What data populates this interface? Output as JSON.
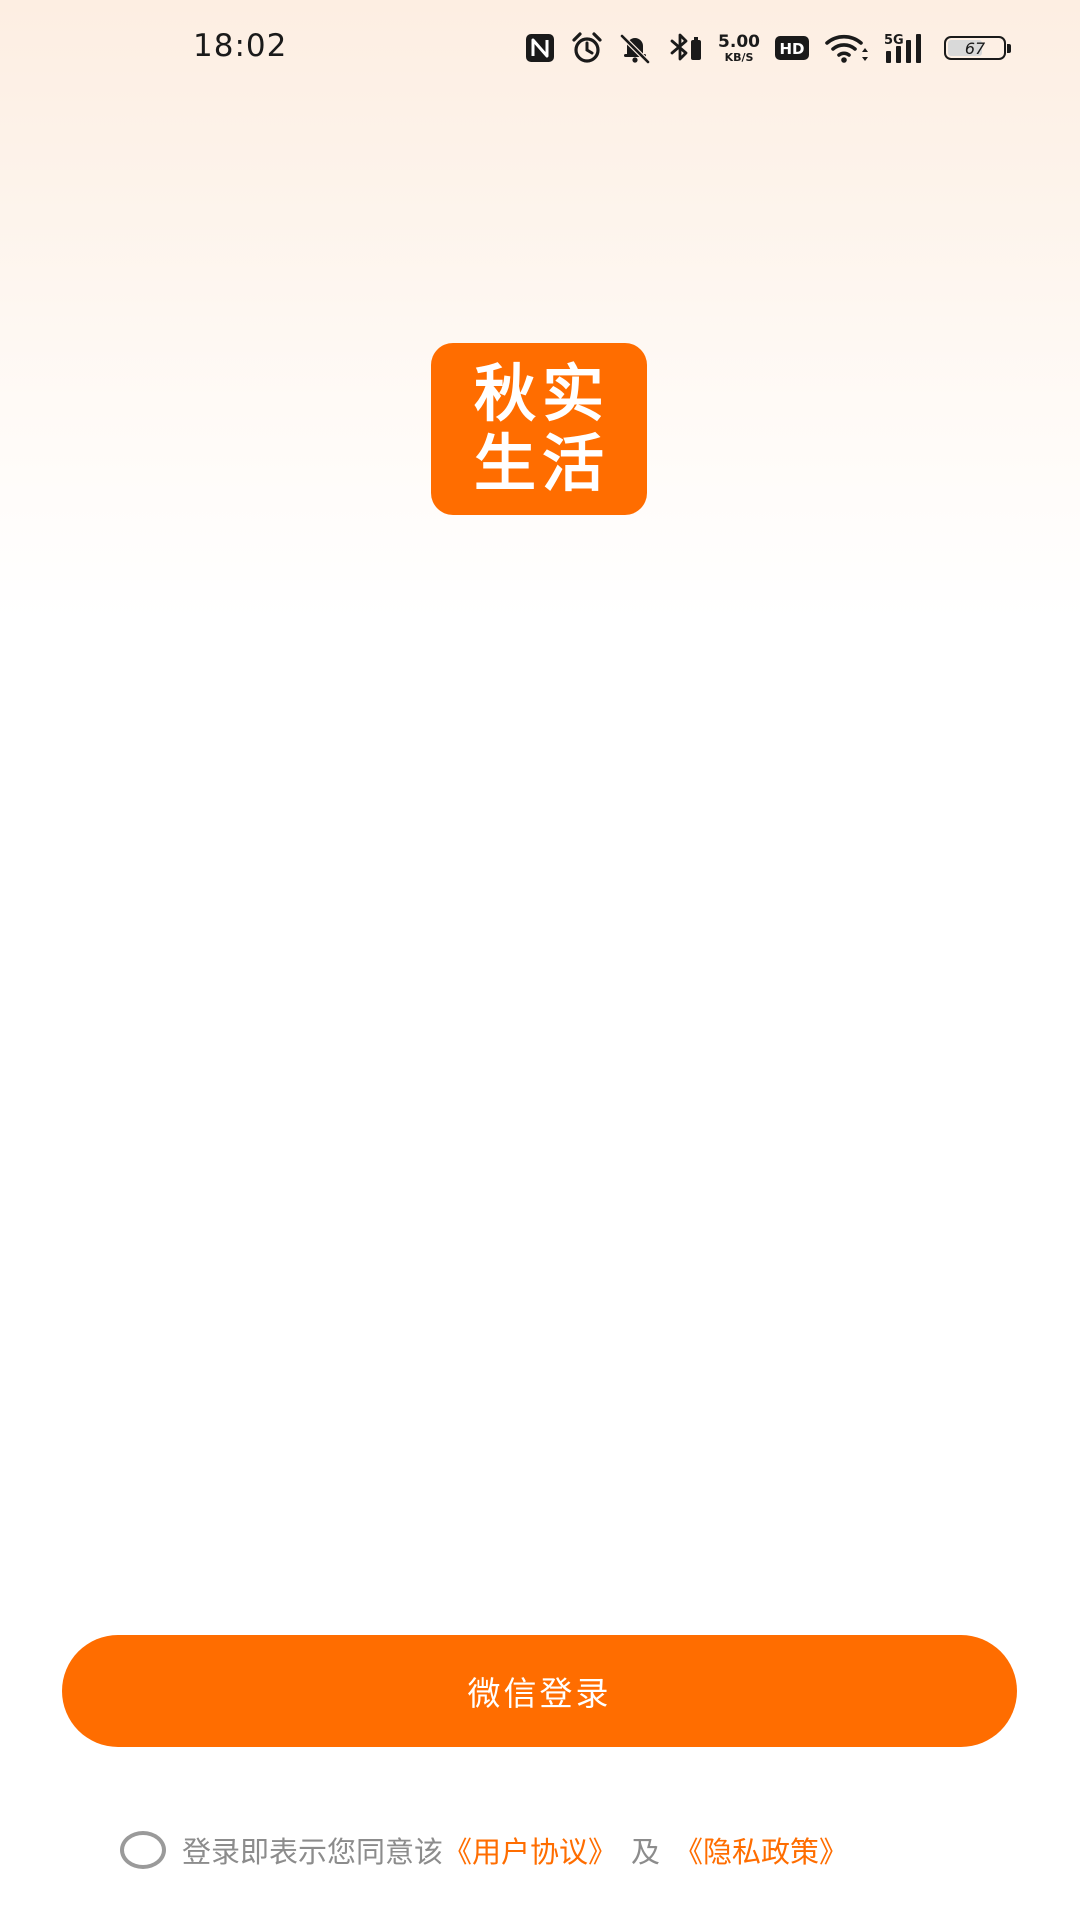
{
  "status_bar": {
    "time": "18:02",
    "net_speed_value": "5.00",
    "net_speed_unit": "KB/S",
    "hd_label": "HD",
    "network_label": "5G",
    "battery_level": "67",
    "icons": [
      "nfc-icon",
      "alarm-icon",
      "mute-icon",
      "bluetooth-icon",
      "hd-icon",
      "wifi-icon",
      "signal-icon",
      "battery-icon"
    ]
  },
  "logo": {
    "line1": "秋实",
    "line2": "生活",
    "color": "#ff6d00"
  },
  "login": {
    "wechat_button_label": "微信登录"
  },
  "agreement": {
    "text": "登录即表示您同意该",
    "user_agreement": "《用户协议》",
    "and": "及",
    "privacy_policy": "《隐私政策》",
    "checked": false
  },
  "colors": {
    "accent": "#ff6d00",
    "muted_text": "#8c8c8c"
  }
}
